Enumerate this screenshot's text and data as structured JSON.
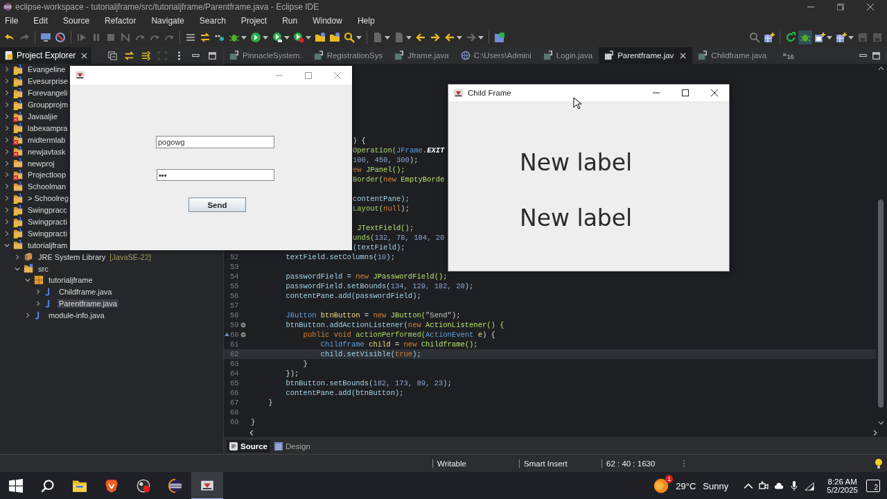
{
  "window": {
    "title": "eclipse-workspace - tutorialjframe/src/tutorialjframe/Parentframe.java - Eclipse IDE"
  },
  "menu": [
    "File",
    "Edit",
    "Source",
    "Refactor",
    "Navigate",
    "Search",
    "Project",
    "Run",
    "Window",
    "Help"
  ],
  "explorer": {
    "title": "Project Explorer",
    "selected": true,
    "tree": [
      {
        "label": "Evangeline",
        "kind": "project",
        "has_error": false,
        "has_warning": true,
        "expanded": false,
        "selected": false
      },
      {
        "label": "Evesurprise",
        "kind": "project",
        "has_error": false,
        "has_warning": true,
        "expanded": false,
        "selected": false
      },
      {
        "label": "Forevangeli",
        "kind": "project",
        "has_error": false,
        "has_warning": true,
        "expanded": false,
        "selected": false
      },
      {
        "label": "Groupprojm",
        "kind": "project",
        "has_error": false,
        "has_warning": true,
        "expanded": false,
        "selected": false
      },
      {
        "label": "Javaaljie",
        "kind": "project",
        "has_error": true,
        "has_warning": false,
        "expanded": false,
        "selected": false
      },
      {
        "label": "labexampra",
        "kind": "project",
        "has_error": false,
        "has_warning": true,
        "expanded": false,
        "selected": false
      },
      {
        "label": "midtermlab",
        "kind": "project",
        "has_error": true,
        "has_warning": false,
        "expanded": false,
        "selected": false
      },
      {
        "label": "newjavtask",
        "kind": "project",
        "has_error": true,
        "has_warning": false,
        "expanded": false,
        "selected": false
      },
      {
        "label": "newproj",
        "kind": "project",
        "has_error": false,
        "has_warning": false,
        "expanded": false,
        "selected": false
      },
      {
        "label": "Projectloop",
        "kind": "project",
        "has_error": true,
        "has_warning": false,
        "expanded": false,
        "selected": false
      },
      {
        "label": "Schoolman",
        "kind": "project",
        "has_error": false,
        "has_warning": false,
        "expanded": false,
        "selected": false
      },
      {
        "label": "> Schoolreg",
        "kind": "project",
        "has_error": false,
        "has_warning": true,
        "expanded": false,
        "selected": false
      },
      {
        "label": "Swingpracc",
        "kind": "project",
        "has_error": false,
        "has_warning": true,
        "expanded": false,
        "selected": false
      },
      {
        "label": "Swingpracti",
        "kind": "project",
        "has_error": false,
        "has_warning": true,
        "expanded": false,
        "selected": false
      },
      {
        "label": "Swingpracti",
        "kind": "project",
        "has_error": false,
        "has_warning": true,
        "expanded": false,
        "selected": false
      },
      {
        "label": "tutorialjfram",
        "kind": "project",
        "has_error": false,
        "has_warning": false,
        "expanded": true,
        "selected": false,
        "children": [
          {
            "label": "JRE System Library",
            "decoration": "[JavaSE-22]",
            "kind": "library",
            "expanded": false,
            "selected": false
          },
          {
            "label": "src",
            "kind": "source",
            "expanded": true,
            "selected": false,
            "children": [
              {
                "label": "tutorialjframe",
                "kind": "package",
                "expanded": true,
                "selected": false,
                "children": [
                  {
                    "label": "Childframe.java",
                    "kind": "java",
                    "expanded": false,
                    "selected": false
                  },
                  {
                    "label": "Parentframe.java",
                    "kind": "java",
                    "expanded": false,
                    "selected": true
                  }
                ]
              },
              {
                "label": "module-info.java",
                "kind": "java",
                "expanded": false,
                "selected": false
              }
            ]
          }
        ]
      }
    ]
  },
  "editor_tabs": [
    {
      "label": "PinnacleSystem.",
      "kind": "class",
      "selected": false
    },
    {
      "label": "RegistrationSys",
      "kind": "class",
      "selected": false
    },
    {
      "label": "Jframe.java",
      "kind": "class",
      "selected": false
    },
    {
      "label": "C:\\Users\\Admini",
      "kind": "web",
      "selected": false
    },
    {
      "label": "Login.java",
      "kind": "class",
      "selected": false
    },
    {
      "label": "Parentframe.jav",
      "kind": "class",
      "selected": true
    },
    {
      "label": "Childframe.java",
      "kind": "class",
      "selected": false
    }
  ],
  "tab_overflow": "»$_{16}$",
  "code": [
    {
      "kind": "partial",
      "current": false,
      "tokens": [
        {
          "text": ") {",
          "kind": "plain"
        }
      ]
    },
    {
      "kind": "partial",
      "current": false,
      "tokens": [
        {
          "text": "Operation(",
          "kind": "fn"
        },
        {
          "text": "JFrame",
          "kind": "type"
        },
        {
          "text": ".",
          "kind": "plain"
        },
        {
          "text": "EXIT",
          "kind": "const"
        }
      ]
    },
    {
      "kind": "partial",
      "current": false,
      "tokens": [
        {
          "text": "100, 450, 300",
          "kind": "num"
        },
        {
          "text": ");",
          "kind": "plain"
        }
      ]
    },
    {
      "kind": "partial",
      "current": false,
      "tokens": [
        {
          "text": "ew",
          "kind": "kw"
        },
        {
          "text": " JPanel();",
          "kind": "cls"
        }
      ]
    },
    {
      "kind": "partial",
      "current": false,
      "tokens": [
        {
          "text": "Border(",
          "kind": "fn"
        },
        {
          "text": "new",
          "kind": "kw"
        },
        {
          "text": " EmptyBorde",
          "kind": "cls"
        }
      ]
    },
    {
      "kind": "blank"
    },
    {
      "kind": "partial",
      "current": false,
      "tokens": [
        {
          "text": "contentPane);",
          "kind": "field"
        }
      ]
    },
    {
      "kind": "partial",
      "current": false,
      "tokens": [
        {
          "text": "Layout(",
          "kind": "fn"
        },
        {
          "text": "null",
          "kind": "kw"
        },
        {
          "text": ");",
          "kind": "plain"
        }
      ]
    },
    {
      "kind": "blank"
    },
    {
      "kind": "partial",
      "current": false,
      "tokens": [
        {
          "text": " JTextField();",
          "kind": "cls"
        }
      ]
    },
    {
      "kind": "partial",
      "current": false,
      "tokens": [
        {
          "text": "unds(",
          "kind": "fn"
        },
        {
          "text": "132, 78, 184, 20",
          "kind": "num"
        }
      ]
    },
    {
      "kind": "partial",
      "current": false,
      "tokens": [
        {
          "text": "(textField);",
          "kind": "field"
        }
      ]
    },
    {
      "kind": "full",
      "number": "52",
      "current": false,
      "fold": false,
      "override": false,
      "tokens": [
        {
          "text": "        textField.setColumns(",
          "kind": "field"
        },
        {
          "text": "10",
          "kind": "num"
        },
        {
          "text": ");",
          "kind": "field"
        }
      ]
    },
    {
      "kind": "full",
      "number": "53",
      "current": false,
      "fold": false,
      "override": false
    },
    {
      "kind": "full",
      "number": "54",
      "current": false,
      "fold": false,
      "override": false,
      "tokens": [
        {
          "text": "        passwordField = ",
          "kind": "field"
        },
        {
          "text": "new",
          "kind": "kw"
        },
        {
          "text": " JPasswordField();",
          "kind": "cls"
        }
      ]
    },
    {
      "kind": "full",
      "number": "55",
      "current": false,
      "fold": false,
      "override": false,
      "tokens": [
        {
          "text": "        passwordField.setBounds(",
          "kind": "field"
        },
        {
          "text": "134, 129, 182, 20",
          "kind": "num"
        },
        {
          "text": ");",
          "kind": "field"
        }
      ]
    },
    {
      "kind": "full",
      "number": "56",
      "current": false,
      "fold": false,
      "override": false,
      "tokens": [
        {
          "text": "        contentPane.add(passwordField);",
          "kind": "field"
        }
      ]
    },
    {
      "kind": "full",
      "number": "57",
      "current": false,
      "fold": false,
      "override": false
    },
    {
      "kind": "full",
      "number": "58",
      "current": false,
      "fold": false,
      "override": false,
      "tokens": [
        {
          "text": "        JButton",
          "kind": "type"
        },
        {
          "text": " btnButton",
          "kind": "local"
        },
        {
          "text": " = ",
          "kind": "plain"
        },
        {
          "text": "new",
          "kind": "kw"
        },
        {
          "text": " JButton(",
          "kind": "cls"
        },
        {
          "text": "\"Send\"",
          "kind": "str"
        },
        {
          "text": ");",
          "kind": "plain"
        }
      ]
    },
    {
      "kind": "full",
      "number": "59",
      "current": false,
      "fold": true,
      "override": false,
      "tokens": [
        {
          "text": "        btnButton.addActionListener(",
          "kind": "field"
        },
        {
          "text": "new",
          "kind": "kw"
        },
        {
          "text": " ActionListener() {",
          "kind": "cls"
        }
      ]
    },
    {
      "kind": "full",
      "number": "60",
      "current": false,
      "fold": true,
      "override": true,
      "tokens": [
        {
          "text": "            public void",
          "kind": "kw"
        },
        {
          "text": " actionPerformed(",
          "kind": "fn"
        },
        {
          "text": "ActionEvent",
          "kind": "type"
        },
        {
          "text": " e",
          "kind": "local"
        },
        {
          "text": ") {",
          "kind": "plain"
        }
      ]
    },
    {
      "kind": "full",
      "number": "61",
      "current": false,
      "fold": false,
      "override": false,
      "tokens": [
        {
          "text": "                Childframe",
          "kind": "type"
        },
        {
          "text": " child",
          "kind": "local"
        },
        {
          "text": " = ",
          "kind": "plain"
        },
        {
          "text": "new",
          "kind": "kw"
        },
        {
          "text": " Childframe();",
          "kind": "cls"
        }
      ]
    },
    {
      "kind": "full",
      "number": "62",
      "current": true,
      "fold": false,
      "override": false,
      "tokens": [
        {
          "text": "                child.setVisible(",
          "kind": "field"
        },
        {
          "text": "true",
          "kind": "kw"
        },
        {
          "text": ");",
          "kind": "field"
        }
      ]
    },
    {
      "kind": "full",
      "number": "63",
      "current": false,
      "fold": false,
      "override": false,
      "tokens": [
        {
          "text": "            }",
          "kind": "plain"
        }
      ]
    },
    {
      "kind": "full",
      "number": "64",
      "current": false,
      "fold": false,
      "override": false,
      "tokens": [
        {
          "text": "        });",
          "kind": "plain"
        }
      ]
    },
    {
      "kind": "full",
      "number": "65",
      "current": false,
      "fold": false,
      "override": false,
      "tokens": [
        {
          "text": "        btnButton.setBounds(",
          "kind": "field"
        },
        {
          "text": "182, 173, 89, 23",
          "kind": "num"
        },
        {
          "text": ");",
          "kind": "field"
        }
      ]
    },
    {
      "kind": "full",
      "number": "66",
      "current": false,
      "fold": false,
      "override": false,
      "tokens": [
        {
          "text": "        contentPane.add(btnButton);",
          "kind": "field"
        }
      ]
    },
    {
      "kind": "full",
      "number": "67",
      "current": false,
      "fold": false,
      "override": false,
      "tokens": [
        {
          "text": "    }",
          "kind": "plain"
        }
      ]
    },
    {
      "kind": "full",
      "number": "68",
      "current": false,
      "fold": false,
      "override": false
    },
    {
      "kind": "full",
      "number": "69",
      "current": false,
      "fold": false,
      "override": false,
      "tokens": [
        {
          "text": "}",
          "kind": "plain"
        }
      ]
    }
  ],
  "editor_modes": [
    {
      "label": "Source",
      "kind": "source",
      "selected": true
    },
    {
      "label": "Design",
      "kind": "design",
      "selected": false
    }
  ],
  "status": [
    "Writable",
    "Smart Insert",
    "62 : 40 : 1630"
  ],
  "parent_frame": {
    "text_field": "pogowg",
    "password_field": "•••",
    "button": "Send"
  },
  "child_frame": {
    "title": "Child Frame",
    "labels": [
      "New label",
      "New label"
    ]
  },
  "taskbar": {
    "apps": [
      {
        "kind": "start",
        "selected": false
      },
      {
        "kind": "search",
        "selected": false
      },
      {
        "kind": "files",
        "selected": false
      },
      {
        "kind": "browser",
        "selected": false
      },
      {
        "kind": "recorder",
        "selected": false
      },
      {
        "kind": "ide",
        "selected": false
      },
      {
        "kind": "java",
        "selected": true
      }
    ],
    "weather": {
      "badge": "1",
      "temperature": "29°C",
      "condition": "Sunny"
    },
    "time": "8:26 AM",
    "date": "5/2/2025",
    "notifications": "2"
  }
}
